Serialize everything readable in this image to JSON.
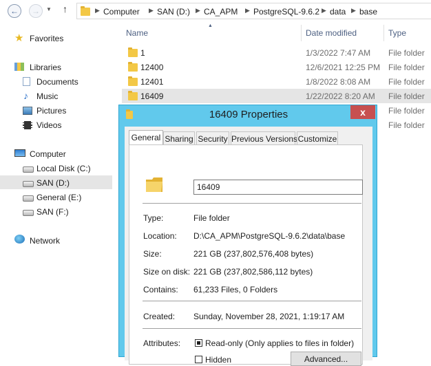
{
  "address": {
    "crumbs": [
      "Computer",
      "SAN (D:)",
      "CA_APM",
      "PostgreSQL-9.6.2",
      "data",
      "base"
    ]
  },
  "nav": {
    "favorites": "Favorites",
    "libraries": "Libraries",
    "documents": "Documents",
    "music": "Music",
    "pictures": "Pictures",
    "videos": "Videos",
    "computer": "Computer",
    "drives": [
      "Local Disk (C:)",
      "SAN (D:)",
      "General (E:)",
      "SAN (F:)"
    ],
    "network": "Network"
  },
  "list": {
    "headers": {
      "name": "Name",
      "date": "Date modified",
      "type": "Type"
    },
    "rows": [
      {
        "name": "1",
        "date": "1/3/2022 7:47 AM",
        "type": "File folder"
      },
      {
        "name": "12400",
        "date": "12/6/2021 12:25 PM",
        "type": "File folder"
      },
      {
        "name": "12401",
        "date": "1/8/2022 8:08 AM",
        "type": "File folder"
      },
      {
        "name": "16409",
        "date": "1/22/2022 8:20 AM",
        "type": "File folder"
      },
      {
        "type": "File folder"
      },
      {
        "type": "File folder"
      }
    ]
  },
  "dialog": {
    "title": "16409 Properties",
    "close": "x",
    "tabs": [
      "General",
      "Sharing",
      "Security",
      "Previous Versions",
      "Customize"
    ],
    "name_value": "16409",
    "fields": {
      "type_label": "Type:",
      "type_value": "File folder",
      "location_label": "Location:",
      "location_value": "D:\\CA_APM\\PostgreSQL-9.6.2\\data\\base",
      "size_label": "Size:",
      "size_value": "221 GB (237,802,576,408 bytes)",
      "size_on_disk_label": "Size on disk:",
      "size_on_disk_value": "221 GB (237,802,586,112 bytes)",
      "contains_label": "Contains:",
      "contains_value": "61,233 Files, 0 Folders",
      "created_label": "Created:",
      "created_value": "Sunday, November 28, 2021, 1:19:17 AM",
      "attributes_label": "Attributes:",
      "readonly_label": "Read-only (Only applies to files in folder)",
      "hidden_label": "Hidden",
      "advanced_button": "Advanced..."
    }
  },
  "colors": {
    "dialog_frame": "#61c9ec",
    "close_button": "#c75050",
    "selection": "#e5e5e5"
  }
}
